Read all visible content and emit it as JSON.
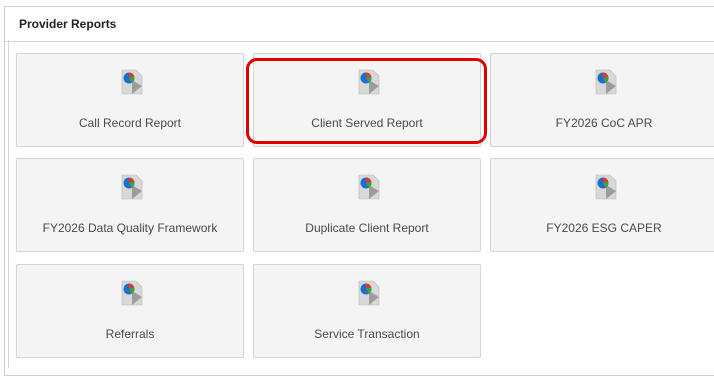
{
  "panel": {
    "title": "Provider Reports"
  },
  "tiles": [
    {
      "label": "Call Record Report",
      "icon": "report-pie-chart-icon"
    },
    {
      "label": "Client Served Report",
      "icon": "report-pie-chart-icon",
      "highlighted": true
    },
    {
      "label": "FY2026 CoC APR",
      "icon": "report-pie-chart-icon"
    },
    {
      "label": "FY2026 Data Quality Framework",
      "icon": "report-pie-chart-icon"
    },
    {
      "label": "Duplicate Client Report",
      "icon": "report-pie-chart-icon"
    },
    {
      "label": "FY2026 ESG CAPER",
      "icon": "report-pie-chart-icon"
    },
    {
      "label": "Referrals",
      "icon": "report-pie-chart-icon"
    },
    {
      "label": "Service Transaction",
      "icon": "report-pie-chart-icon"
    }
  ],
  "colors": {
    "highlight": "#e00000",
    "tile_bg": "#f4f4f4",
    "border": "#d4d4d4",
    "label": "#4a4a4a"
  }
}
